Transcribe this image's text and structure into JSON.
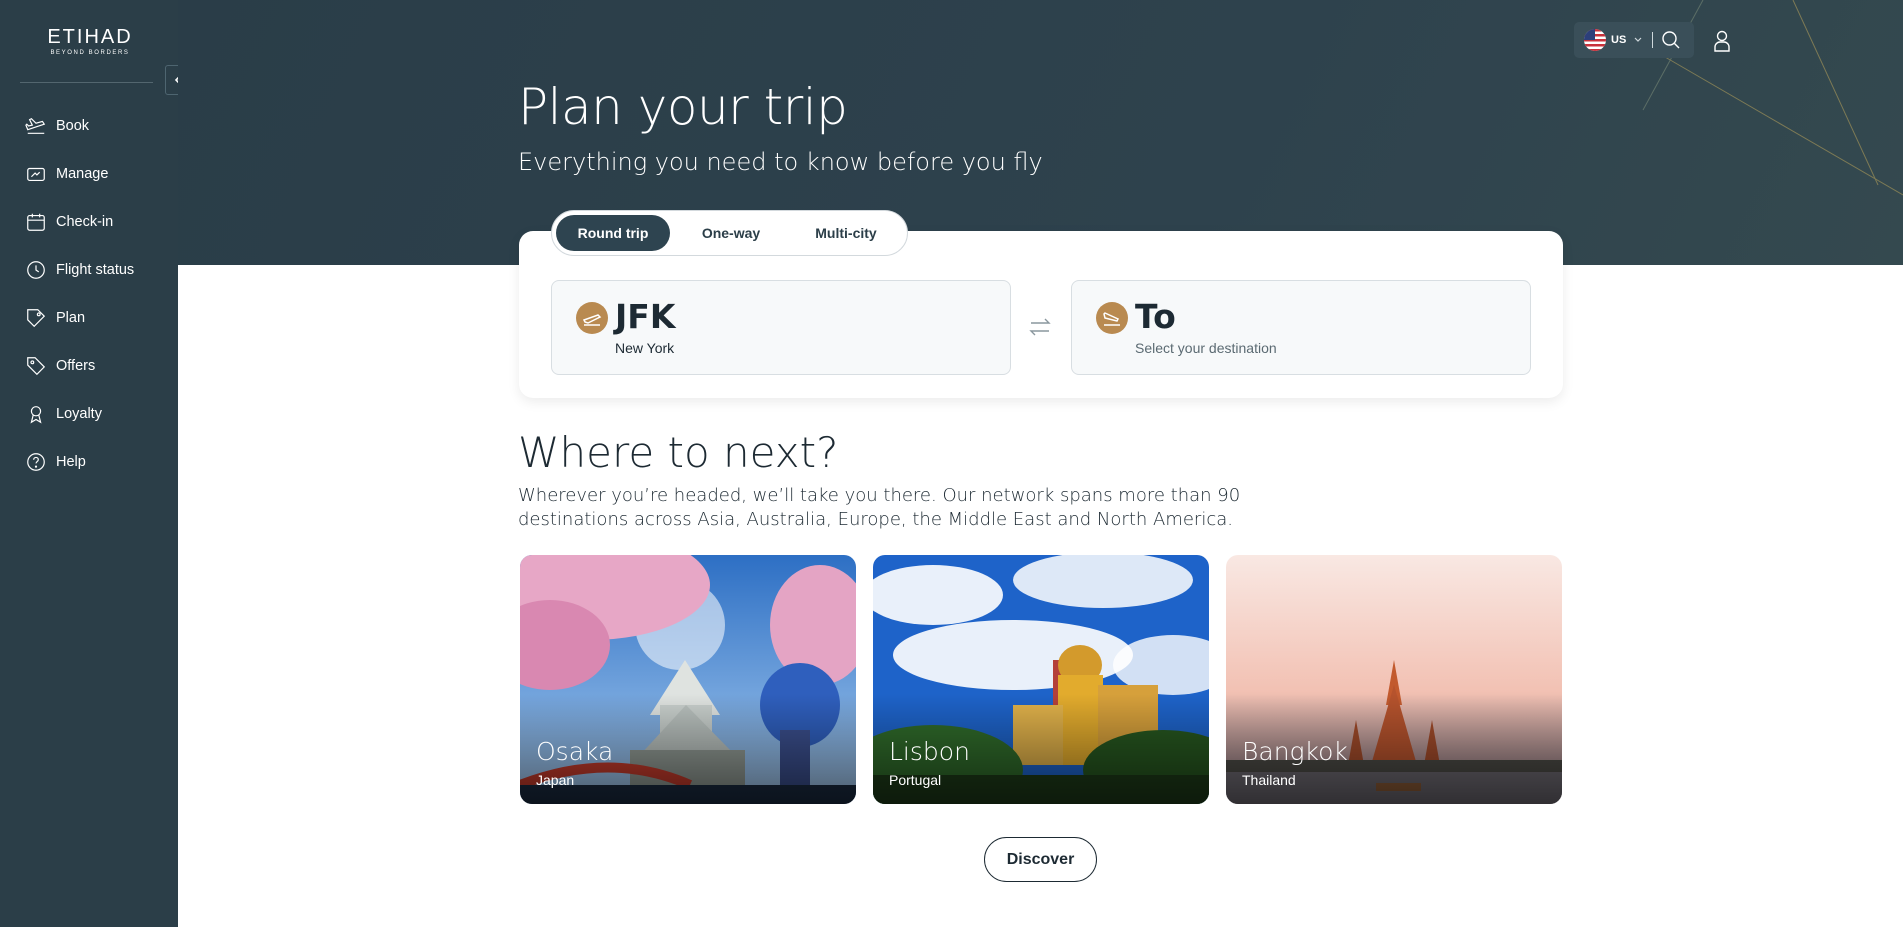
{
  "brand": {
    "name": "ETIHAD",
    "tagline": "BEYOND BORDERS"
  },
  "sidebar": {
    "items": [
      {
        "label": "Book",
        "icon": "plane-icon"
      },
      {
        "label": "Manage",
        "icon": "ticket-icon"
      },
      {
        "label": "Check-in",
        "icon": "calendar-icon"
      },
      {
        "label": "Flight status",
        "icon": "clock-icon"
      },
      {
        "label": "Plan",
        "icon": "luggage-tag-icon"
      },
      {
        "label": "Offers",
        "icon": "price-tag-icon"
      },
      {
        "label": "Loyalty",
        "icon": "award-icon"
      },
      {
        "label": "Help",
        "icon": "question-icon"
      }
    ]
  },
  "header": {
    "country_code": "US"
  },
  "hero": {
    "title": "Plan your trip",
    "subtitle": "Everything you need to know before you fly"
  },
  "booking": {
    "tabs": [
      {
        "label": "Round trip",
        "active": true
      },
      {
        "label": "One-way",
        "active": false
      },
      {
        "label": "Multi-city",
        "active": false
      }
    ],
    "origin": {
      "code": "JFK",
      "city": "New York"
    },
    "destination": {
      "code": "To",
      "city": "Select your destination"
    }
  },
  "destinations": {
    "title": "Where to next?",
    "description": "Wherever you’re headed, we’ll take you there. Our network spans more than 90 destinations across Asia, Australia, Europe, the Middle East and North America.",
    "cards": [
      {
        "city": "Osaka",
        "country": "Japan"
      },
      {
        "city": "Lisbon",
        "country": "Portugal"
      },
      {
        "city": "Bangkok",
        "country": "Thailand"
      }
    ],
    "discover_label": "Discover"
  },
  "colors": {
    "sidebar": "#2b3e48",
    "hero": "#2e424d",
    "accent_gold": "#b98a50",
    "active_tab": "#2e4450"
  }
}
